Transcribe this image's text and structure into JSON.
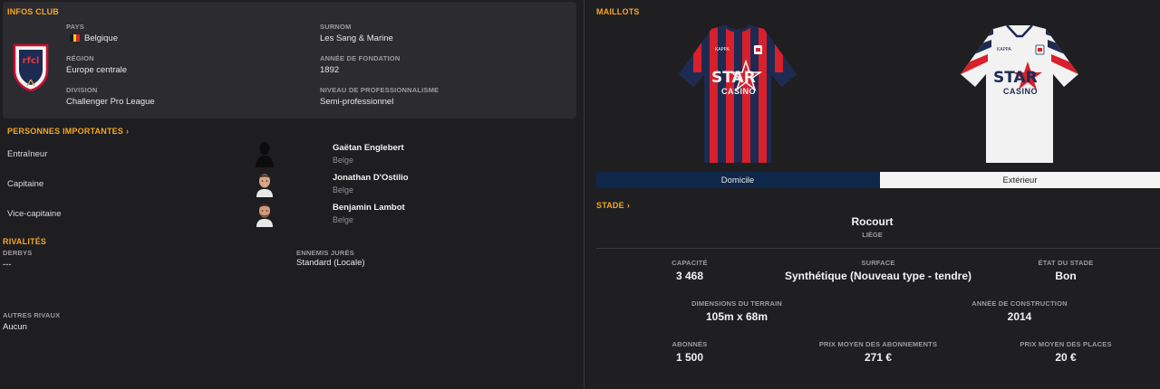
{
  "club_info": {
    "title": "INFOS CLUB",
    "country_label": "PAYS",
    "country_value": "Belgique",
    "nickname_label": "SURNOM",
    "nickname_value": "Les Sang & Marine",
    "region_label": "RÉGION",
    "region_value": "Europe centrale",
    "founded_label": "ANNÉE DE FONDATION",
    "founded_value": "1892",
    "division_label": "DIVISION",
    "division_value": "Challenger Pro League",
    "professionalism_label": "NIVEAU DE PROFESSIONNALISME",
    "professionalism_value": "Semi-professionnel",
    "crest_text": "rfcl",
    "flag_colors": [
      "#1a1a1a",
      "#f5d20a",
      "#d8262c"
    ]
  },
  "key_people": {
    "title": "PERSONNES IMPORTANTES",
    "chevron": "›",
    "people": [
      {
        "role": "Entraîneur",
        "name": "Gaëtan Englebert",
        "nationality": "Belge",
        "avatar": "silhouette-icon"
      },
      {
        "role": "Capitaine",
        "name": "Jonathan D'Ostilio",
        "nationality": "Belge",
        "avatar": "face-photo"
      },
      {
        "role": "Vice-capitaine",
        "name": "Benjamin Lambot",
        "nationality": "Belge",
        "avatar": "face-photo"
      }
    ]
  },
  "rivalries": {
    "title": "RIVALITÉS",
    "derbies_label": "DERBYS",
    "derbies_value": "---",
    "sworn_enemies_label": "ENNEMIS JURÉS",
    "sworn_enemies_value": "Standard (Locale)",
    "other_rivals_label": "AUTRES RIVAUX",
    "other_rivals_value": "Aucun"
  },
  "kits": {
    "title": "MAILLOTS",
    "sponsor_line1": "STAR",
    "sponsor_line2": "CASINO",
    "maker": "KAPPA",
    "tabs": [
      {
        "label": "Domicile",
        "active": true
      },
      {
        "label": "Extérieur",
        "active": false
      }
    ],
    "home_colors": [
      "#d7202b",
      "#1d2b52"
    ],
    "away_colors": [
      "#f2f2f2",
      "#1d2b52",
      "#d7202b"
    ]
  },
  "stadium": {
    "title": "STADE",
    "chevron": "›",
    "name": "Rocourt",
    "city": "LIÈGE",
    "stats": {
      "capacity_label": "CAPACITÉ",
      "capacity_value": "3 468",
      "surface_label": "SURFACE",
      "surface_value": "Synthétique (Nouveau type - tendre)",
      "condition_label": "ÉTAT DU STADE",
      "condition_value": "Bon",
      "dimensions_label": "DIMENSIONS DU TERRAIN",
      "dimensions_value": "105m x 68m",
      "built_label": "ANNÉE DE CONSTRUCTION",
      "built_value": "2014",
      "subscribers_label": "ABONNÉS",
      "subscribers_value": "1 500",
      "avg_season_ticket_label": "PRIX MOYEN DES ABONNEMENTS",
      "avg_season_ticket_value": "271 €",
      "avg_ticket_label": "PRIX MOYEN DES PLACES",
      "avg_ticket_value": "20 €"
    }
  }
}
